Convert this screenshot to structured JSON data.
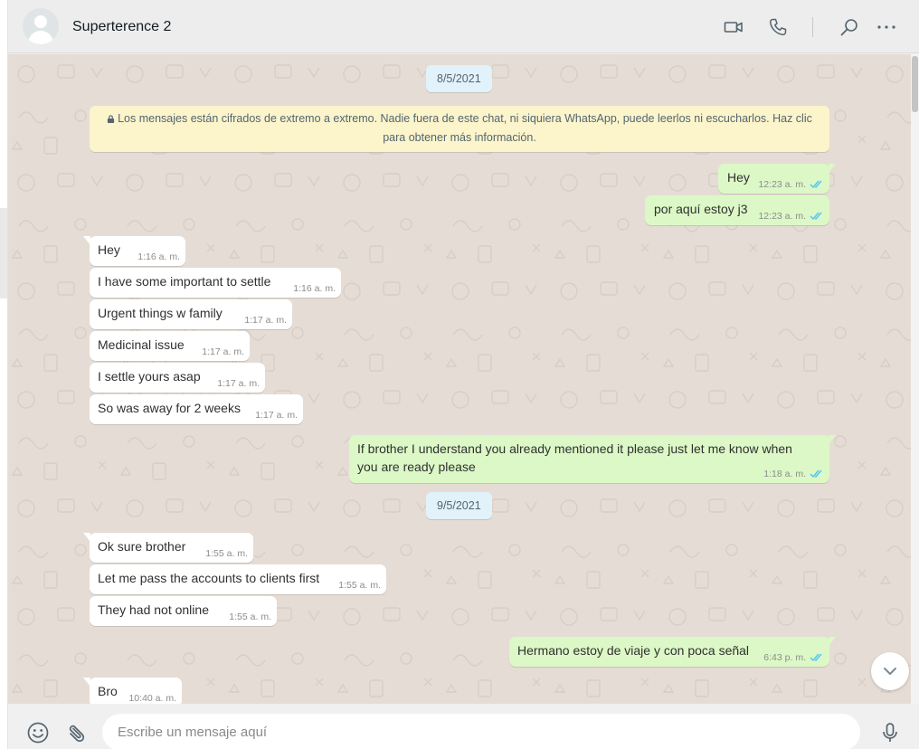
{
  "header": {
    "contact_name": "Superterence 2",
    "icons": [
      "video-call-icon",
      "voice-call-icon",
      "search-icon",
      "menu-icon"
    ]
  },
  "chat": {
    "system_message": "Los mensajes están cifrados de extremo a extremo. Nadie fuera de este chat, ni siquiera WhatsApp, puede leerlos ni escucharlos. Haz clic para obtener más información.",
    "dates": [
      "8/5/2021",
      "9/5/2021"
    ],
    "messages": [
      {
        "dir": "out",
        "text": "Hey",
        "time": "12:23 a. m."
      },
      {
        "dir": "out",
        "text": "por aquí estoy j3",
        "time": "12:23 a. m."
      },
      {
        "dir": "in",
        "text": "Hey",
        "time": "1:16 a. m."
      },
      {
        "dir": "in",
        "text": "I have some important to settle",
        "time": "1:16 a. m."
      },
      {
        "dir": "in",
        "text": "Urgent things w family",
        "time": "1:17 a. m."
      },
      {
        "dir": "in",
        "text": "Medicinal issue",
        "time": "1:17 a. m."
      },
      {
        "dir": "in",
        "text": "I settle yours asap",
        "time": "1:17 a. m."
      },
      {
        "dir": "in",
        "text": "So was away for 2 weeks",
        "time": "1:17 a. m."
      },
      {
        "dir": "out",
        "text": "If brother I understand you already mentioned it please just let me know when you are ready please",
        "time": "1:18 a. m."
      },
      {
        "dir": "in",
        "text": "Ok sure brother",
        "time": "1:55 a. m."
      },
      {
        "dir": "in",
        "text": "Let me pass the accounts to clients first",
        "time": "1:55 a. m."
      },
      {
        "dir": "in",
        "text": "They had not online",
        "time": "1:55 a. m."
      },
      {
        "dir": "out",
        "text": "Hermano estoy de viaje y con poca señal",
        "time": "6:43 p. m."
      },
      {
        "dir": "in",
        "text": "Bro",
        "time": "10:40 a. m."
      }
    ]
  },
  "composer": {
    "placeholder": "Escribe un mensaje aquí",
    "icons": [
      "emoji-icon",
      "attach-icon",
      "microphone-icon"
    ]
  },
  "colors": {
    "chat_background": "#e5ddd5",
    "outgoing_bubble": "#dcf8c6",
    "incoming_bubble": "#ffffff",
    "date_pill": "#e1f2fb",
    "system_message": "#fcf4cb",
    "read_ticks": "#4fc3f7"
  }
}
